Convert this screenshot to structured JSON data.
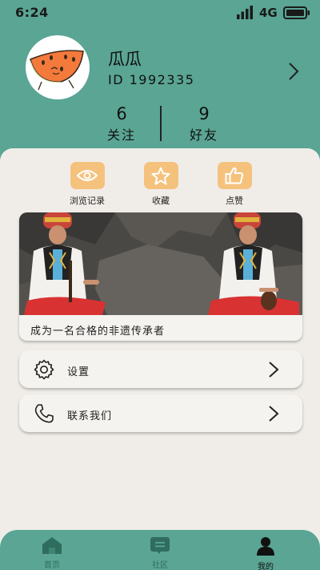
{
  "status_bar": {
    "time": "6:24",
    "network": "4G"
  },
  "profile": {
    "username": "瓜瓜",
    "user_id": "ID 1992335"
  },
  "stats": [
    {
      "value": "6",
      "label": "关注"
    },
    {
      "value": "9",
      "label": "好友"
    }
  ],
  "quick_actions": [
    {
      "label": "浏览记录",
      "icon": "eye-icon"
    },
    {
      "label": "收藏",
      "icon": "star-icon"
    },
    {
      "label": "点赞",
      "icon": "thumbs-up-icon"
    }
  ],
  "banner": {
    "caption": "成为一名合格的非遗传承者"
  },
  "menu": [
    {
      "label": "设置",
      "icon": "gear-icon"
    },
    {
      "label": "联系我们",
      "icon": "phone-icon"
    }
  ],
  "tabs": [
    {
      "label": "首页",
      "icon": "home-icon"
    },
    {
      "label": "社区",
      "icon": "community-icon"
    },
    {
      "label": "我的",
      "icon": "user-icon",
      "active": true
    }
  ],
  "colors": {
    "primary": "#5aa594",
    "accent": "#f5c27e",
    "background": "#f0ede8"
  }
}
